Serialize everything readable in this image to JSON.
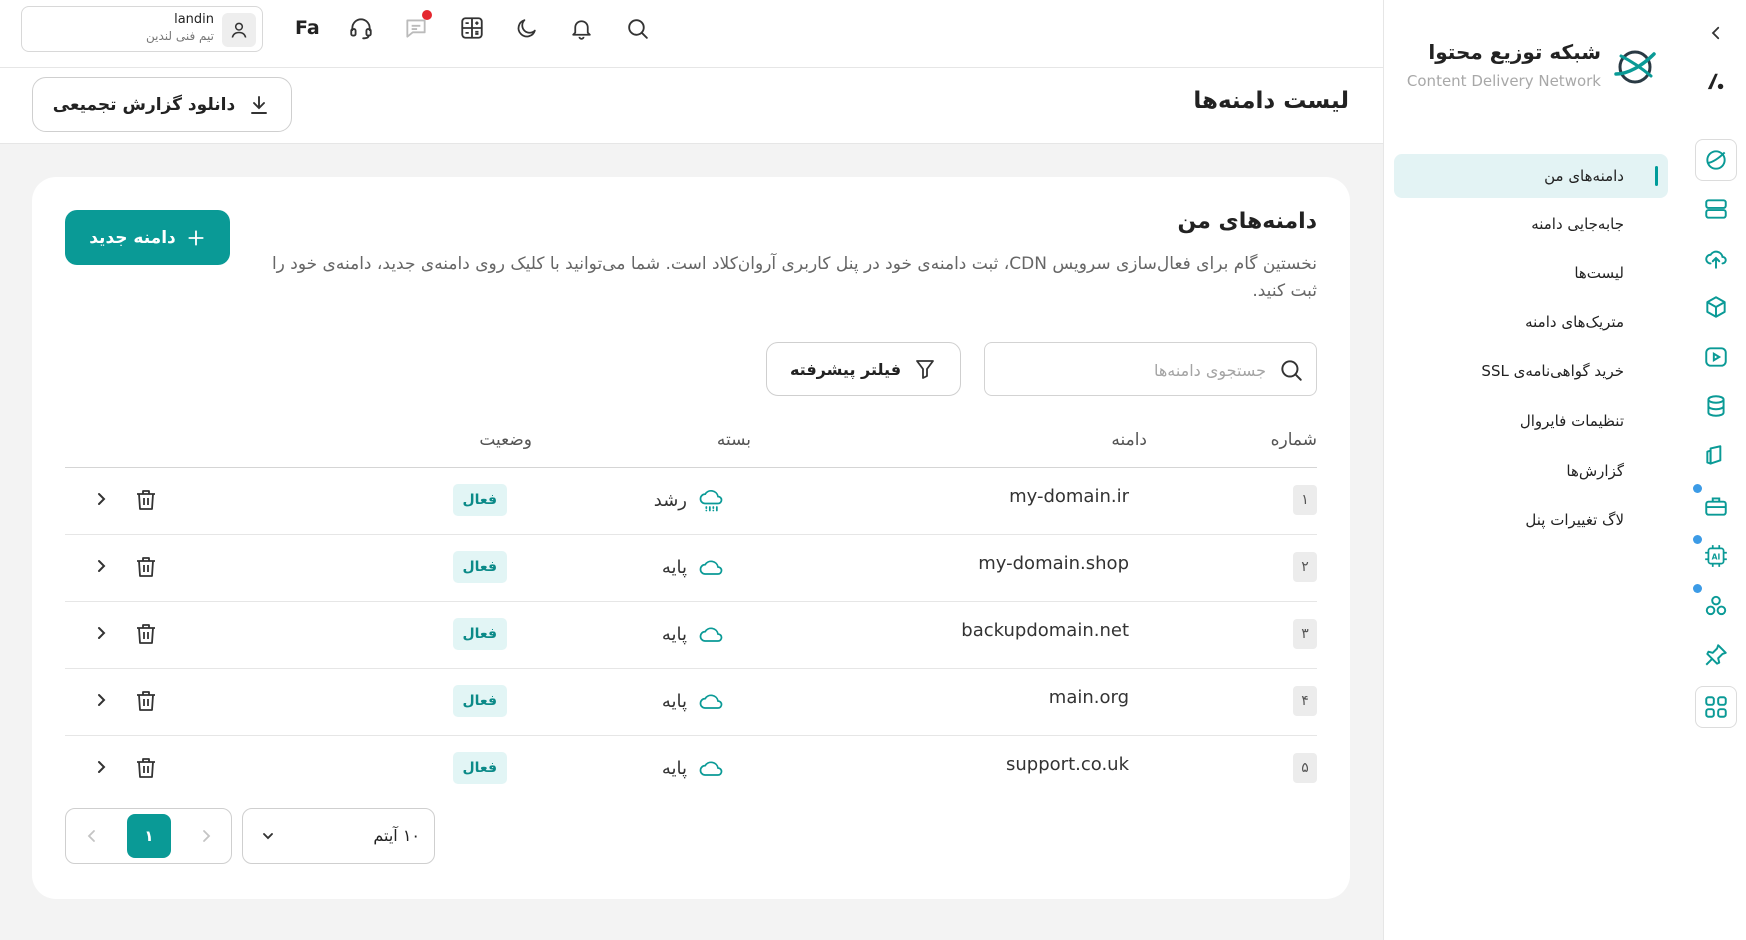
{
  "colors": {
    "accent": "#0a9a96",
    "accent_soft": "#e3f3f4",
    "badge_text": "#0b8a88",
    "notify_dot": "#e4262e",
    "rail_dot": "#3c9be6"
  },
  "topbar": {
    "user": {
      "name": "landin",
      "team": "تیم فنی لندین",
      "icon": "user-icon"
    },
    "lang": "Fa",
    "icons": [
      "search-icon",
      "bell-icon",
      "moon-icon",
      "calculator-icon",
      "chat-icon",
      "headset-icon"
    ]
  },
  "sidebar": {
    "brand_title": "شبکه توزیع محتوا",
    "brand_subtitle": "Content Delivery Network",
    "items": [
      {
        "label": "دامنه‌های من",
        "active": true
      },
      {
        "label": "جابه‌جایی دامنه"
      },
      {
        "label": "لیست‌ها"
      },
      {
        "label": "متریک‌های دامنه"
      },
      {
        "label": "خرید گواهی‌نامه‌ی SSL"
      },
      {
        "label": "تنظیمات فایروال"
      },
      {
        "label": "گزارش‌ها"
      },
      {
        "label": "لاگ تغییرات پنل"
      }
    ]
  },
  "rail": {
    "icons": [
      "collapse-chevron-icon",
      "logo-icon",
      "cdn-icon",
      "server-icon",
      "cloud-upload-icon",
      "box-icon",
      "video-icon",
      "database-icon",
      "layers-icon",
      "briefcase-icon",
      "ai-chip-icon",
      "cluster-icon",
      "pin-icon",
      "apps-grid-icon"
    ]
  },
  "page": {
    "title": "لیست دامنه‌ها",
    "download_label": "دانلود گزارش تجمیعی"
  },
  "card": {
    "title": "دامنه‌های من",
    "description": "نخستین گام برای فعال‌سازی سرویس CDN، ثبت دامنه‌ی خود در پنل کاربری آروان‌کلاد است. شما می‌توانید با کلیک روی دامنه‌ی جدید، دامنه‌ی خود را ثبت کنید.",
    "new_label": "دامنه جدید",
    "search_placeholder": "جستجوی دامنه‌ها",
    "filter_label": "فیلتر پیشرفته"
  },
  "table": {
    "headers": {
      "number": "شماره",
      "domain": "دامنه",
      "plan": "بسته",
      "status": "وضعیت"
    },
    "rows": [
      {
        "num": "۱",
        "domain": "my-domain.ir",
        "plan": "رشد",
        "plan_icon": "cloud-rain-icon",
        "status": "فعال"
      },
      {
        "num": "۲",
        "domain": "my-domain.shop",
        "plan": "پایه",
        "plan_icon": "cloud-icon",
        "status": "فعال"
      },
      {
        "num": "۳",
        "domain": "backupdomain.net",
        "plan": "پایه",
        "plan_icon": "cloud-icon",
        "status": "فعال"
      },
      {
        "num": "۴",
        "domain": "main.org",
        "plan": "پایه",
        "plan_icon": "cloud-icon",
        "status": "فعال"
      },
      {
        "num": "۵",
        "domain": "support.co.uk",
        "plan": "پایه",
        "plan_icon": "cloud-icon",
        "status": "فعال"
      }
    ]
  },
  "pagination": {
    "current_page": "۱",
    "page_size": "۱۰ آیتم"
  }
}
